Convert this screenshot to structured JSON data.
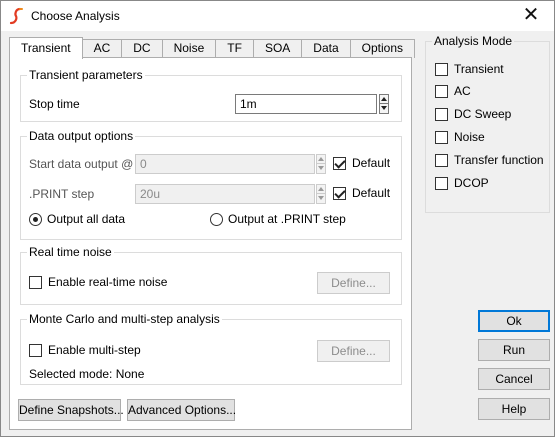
{
  "window": {
    "title": "Choose Analysis",
    "close_glyph": "✕"
  },
  "tabs": [
    {
      "label": "Transient",
      "active": true
    },
    {
      "label": "AC"
    },
    {
      "label": "DC"
    },
    {
      "label": "Noise"
    },
    {
      "label": "TF"
    },
    {
      "label": "SOA"
    },
    {
      "label": "Data"
    },
    {
      "label": "Options"
    }
  ],
  "transient_params": {
    "title": "Transient parameters",
    "stop_time_label": "Stop time",
    "stop_time_value": "1m"
  },
  "data_output": {
    "title": "Data output options",
    "start_label": "Start data output @",
    "start_value": "0",
    "start_default_label": "Default",
    "print_step_label": ".PRINT step",
    "print_step_value": "20u",
    "print_default_label": "Default",
    "radio_all_label": "Output all data",
    "radio_print_label": "Output at .PRINT step"
  },
  "noise": {
    "title": "Real time noise",
    "enable_label": "Enable real-time noise",
    "define_label": "Define..."
  },
  "monte_carlo": {
    "title": "Monte Carlo and multi-step analysis",
    "enable_label": "Enable multi-step",
    "define_label": "Define...",
    "mode_text": "Selected mode: None"
  },
  "bottom_buttons": {
    "snapshots_label": "Define Snapshots...",
    "advanced_label": "Advanced Options..."
  },
  "analysis_mode": {
    "title": "Analysis Mode",
    "items": [
      "Transient",
      "AC",
      "DC Sweep",
      "Noise",
      "Transfer function",
      "DCOP"
    ]
  },
  "dialog_buttons": {
    "ok": "Ok",
    "run": "Run",
    "cancel": "Cancel",
    "help": "Help"
  },
  "colors": {
    "accent": "#0078d7",
    "panel_bg": "#ffffff",
    "window_bg": "#f0f0f0",
    "app_icon": "#e23a22"
  }
}
